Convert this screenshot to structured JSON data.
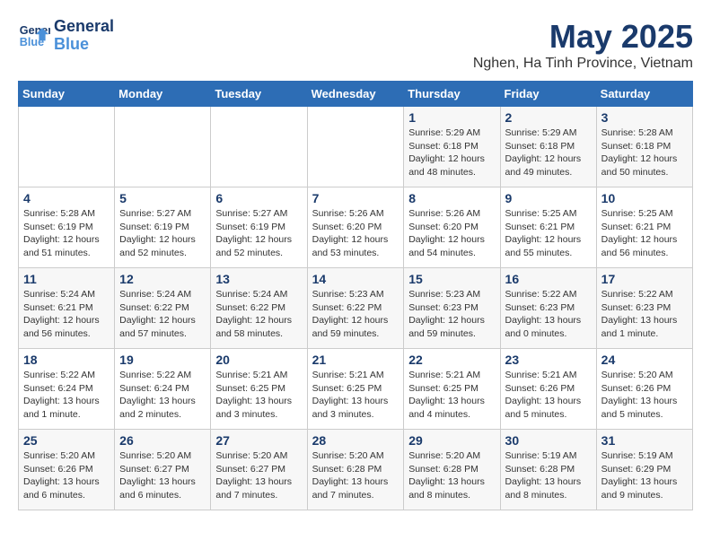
{
  "logo": {
    "line1": "General",
    "line2": "Blue"
  },
  "title": "May 2025",
  "subtitle": "Nghen, Ha Tinh Province, Vietnam",
  "days_of_week": [
    "Sunday",
    "Monday",
    "Tuesday",
    "Wednesday",
    "Thursday",
    "Friday",
    "Saturday"
  ],
  "weeks": [
    [
      {
        "day": "",
        "info": ""
      },
      {
        "day": "",
        "info": ""
      },
      {
        "day": "",
        "info": ""
      },
      {
        "day": "",
        "info": ""
      },
      {
        "day": "1",
        "info": "Sunrise: 5:29 AM\nSunset: 6:18 PM\nDaylight: 12 hours\nand 48 minutes."
      },
      {
        "day": "2",
        "info": "Sunrise: 5:29 AM\nSunset: 6:18 PM\nDaylight: 12 hours\nand 49 minutes."
      },
      {
        "day": "3",
        "info": "Sunrise: 5:28 AM\nSunset: 6:18 PM\nDaylight: 12 hours\nand 50 minutes."
      }
    ],
    [
      {
        "day": "4",
        "info": "Sunrise: 5:28 AM\nSunset: 6:19 PM\nDaylight: 12 hours\nand 51 minutes."
      },
      {
        "day": "5",
        "info": "Sunrise: 5:27 AM\nSunset: 6:19 PM\nDaylight: 12 hours\nand 52 minutes."
      },
      {
        "day": "6",
        "info": "Sunrise: 5:27 AM\nSunset: 6:19 PM\nDaylight: 12 hours\nand 52 minutes."
      },
      {
        "day": "7",
        "info": "Sunrise: 5:26 AM\nSunset: 6:20 PM\nDaylight: 12 hours\nand 53 minutes."
      },
      {
        "day": "8",
        "info": "Sunrise: 5:26 AM\nSunset: 6:20 PM\nDaylight: 12 hours\nand 54 minutes."
      },
      {
        "day": "9",
        "info": "Sunrise: 5:25 AM\nSunset: 6:21 PM\nDaylight: 12 hours\nand 55 minutes."
      },
      {
        "day": "10",
        "info": "Sunrise: 5:25 AM\nSunset: 6:21 PM\nDaylight: 12 hours\nand 56 minutes."
      }
    ],
    [
      {
        "day": "11",
        "info": "Sunrise: 5:24 AM\nSunset: 6:21 PM\nDaylight: 12 hours\nand 56 minutes."
      },
      {
        "day": "12",
        "info": "Sunrise: 5:24 AM\nSunset: 6:22 PM\nDaylight: 12 hours\nand 57 minutes."
      },
      {
        "day": "13",
        "info": "Sunrise: 5:24 AM\nSunset: 6:22 PM\nDaylight: 12 hours\nand 58 minutes."
      },
      {
        "day": "14",
        "info": "Sunrise: 5:23 AM\nSunset: 6:22 PM\nDaylight: 12 hours\nand 59 minutes."
      },
      {
        "day": "15",
        "info": "Sunrise: 5:23 AM\nSunset: 6:23 PM\nDaylight: 12 hours\nand 59 minutes."
      },
      {
        "day": "16",
        "info": "Sunrise: 5:22 AM\nSunset: 6:23 PM\nDaylight: 13 hours\nand 0 minutes."
      },
      {
        "day": "17",
        "info": "Sunrise: 5:22 AM\nSunset: 6:23 PM\nDaylight: 13 hours\nand 1 minute."
      }
    ],
    [
      {
        "day": "18",
        "info": "Sunrise: 5:22 AM\nSunset: 6:24 PM\nDaylight: 13 hours\nand 1 minute."
      },
      {
        "day": "19",
        "info": "Sunrise: 5:22 AM\nSunset: 6:24 PM\nDaylight: 13 hours\nand 2 minutes."
      },
      {
        "day": "20",
        "info": "Sunrise: 5:21 AM\nSunset: 6:25 PM\nDaylight: 13 hours\nand 3 minutes."
      },
      {
        "day": "21",
        "info": "Sunrise: 5:21 AM\nSunset: 6:25 PM\nDaylight: 13 hours\nand 3 minutes."
      },
      {
        "day": "22",
        "info": "Sunrise: 5:21 AM\nSunset: 6:25 PM\nDaylight: 13 hours\nand 4 minutes."
      },
      {
        "day": "23",
        "info": "Sunrise: 5:21 AM\nSunset: 6:26 PM\nDaylight: 13 hours\nand 5 minutes."
      },
      {
        "day": "24",
        "info": "Sunrise: 5:20 AM\nSunset: 6:26 PM\nDaylight: 13 hours\nand 5 minutes."
      }
    ],
    [
      {
        "day": "25",
        "info": "Sunrise: 5:20 AM\nSunset: 6:26 PM\nDaylight: 13 hours\nand 6 minutes."
      },
      {
        "day": "26",
        "info": "Sunrise: 5:20 AM\nSunset: 6:27 PM\nDaylight: 13 hours\nand 6 minutes."
      },
      {
        "day": "27",
        "info": "Sunrise: 5:20 AM\nSunset: 6:27 PM\nDaylight: 13 hours\nand 7 minutes."
      },
      {
        "day": "28",
        "info": "Sunrise: 5:20 AM\nSunset: 6:28 PM\nDaylight: 13 hours\nand 7 minutes."
      },
      {
        "day": "29",
        "info": "Sunrise: 5:20 AM\nSunset: 6:28 PM\nDaylight: 13 hours\nand 8 minutes."
      },
      {
        "day": "30",
        "info": "Sunrise: 5:19 AM\nSunset: 6:28 PM\nDaylight: 13 hours\nand 8 minutes."
      },
      {
        "day": "31",
        "info": "Sunrise: 5:19 AM\nSunset: 6:29 PM\nDaylight: 13 hours\nand 9 minutes."
      }
    ]
  ]
}
